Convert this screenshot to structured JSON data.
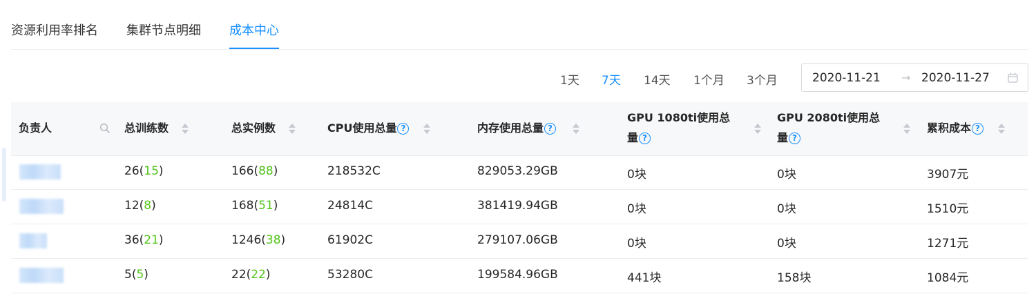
{
  "tabs": [
    {
      "label": "资源利用率排名"
    },
    {
      "label": "集群节点明细"
    },
    {
      "label": "成本中心"
    }
  ],
  "active_tab": "成本中心",
  "ranges": [
    {
      "label": "1天"
    },
    {
      "label": "7天"
    },
    {
      "label": "14天"
    },
    {
      "label": "1个月"
    },
    {
      "label": "3个月"
    }
  ],
  "active_range": "7天",
  "date_range": {
    "start": "2020-11-21",
    "separator": "→",
    "end": "2020-11-27"
  },
  "table": {
    "headers": {
      "owner": "负责人",
      "trainings": "总训练数",
      "instances": "总实例数",
      "cpu": "CPU使用总量",
      "memory": "内存使用总量",
      "gpu1080_line1": "GPU 1080ti使用总",
      "gpu1080_line2": "量",
      "gpu2080_line1": "GPU 2080ti使用总",
      "gpu2080_line2": "量",
      "cost": "累积成本"
    },
    "help_glyph": "?",
    "rows": [
      {
        "trainings_total": "26",
        "trainings_sub": "15",
        "instances_total": "166",
        "instances_sub": "88",
        "cpu": "218532C",
        "memory": "829053.29GB",
        "gpu1080": "0块",
        "gpu2080": "0块",
        "cost": "3907元"
      },
      {
        "trainings_total": "12",
        "trainings_sub": "8",
        "instances_total": "168",
        "instances_sub": "51",
        "cpu": "24814C",
        "memory": "381419.94GB",
        "gpu1080": "0块",
        "gpu2080": "0块",
        "cost": "1510元"
      },
      {
        "trainings_total": "36",
        "trainings_sub": "21",
        "instances_total": "1246",
        "instances_sub": "38",
        "cpu": "61902C",
        "memory": "279107.06GB",
        "gpu1080": "0块",
        "gpu2080": "0块",
        "cost": "1271元"
      },
      {
        "trainings_total": "5",
        "trainings_sub": "5",
        "instances_total": "22",
        "instances_sub": "22",
        "cpu": "53280C",
        "memory": "199584.96GB",
        "gpu1080": "441块",
        "gpu2080": "158块",
        "cost": "1084元"
      }
    ]
  },
  "colors": {
    "accent": "#1890ff",
    "sub_count": "#52c41a"
  }
}
